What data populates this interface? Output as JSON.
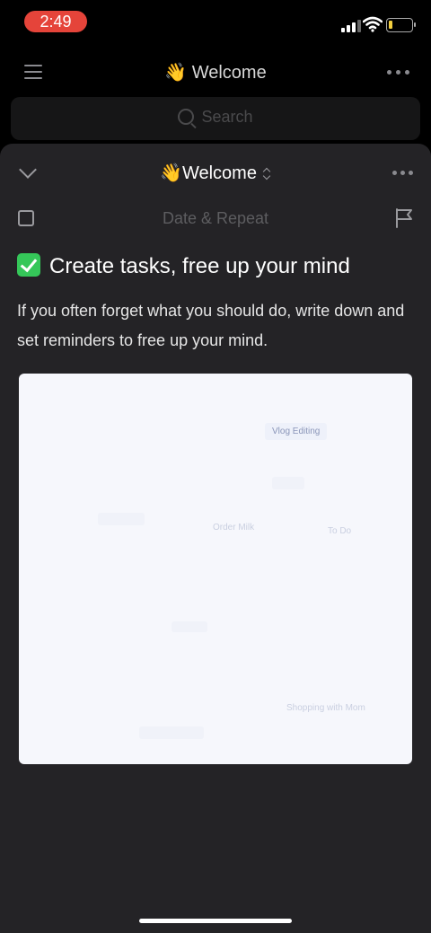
{
  "status_bar": {
    "time": "2:49",
    "signal_icon": "cellular-signal-icon",
    "wifi_icon": "wifi-icon",
    "battery_icon": "battery-low-icon",
    "battery_level": 0.15
  },
  "background_header": {
    "menu_icon": "hamburger-menu-icon",
    "title": "👋 Welcome",
    "more_icon": "more-dots-icon"
  },
  "search": {
    "placeholder": "Search",
    "icon": "search-icon"
  },
  "sheet": {
    "collapse_icon": "chevron-down-icon",
    "list_title": "👋Welcome",
    "switch_icon": "up-down-chevron-icon",
    "more_icon": "more-dots-icon",
    "checkbox_checked": false,
    "date_repeat_label": "Date & Repeat",
    "flag_icon": "flag-icon"
  },
  "task": {
    "title": "Create tasks, free up your mind",
    "title_icon": "check-mark-button-icon",
    "description": "If you often forget what you should do, write down and set reminders to free up your mind."
  },
  "illustration": {
    "tags": [
      "Vlog Editing",
      "Order Milk",
      "To Do",
      "Shopping with Mom"
    ]
  },
  "colors": {
    "time_pill": "#e5443a",
    "sheet_bg": "#242326",
    "check_green": "#35c759",
    "battery_yellow": "#f4d03f"
  }
}
